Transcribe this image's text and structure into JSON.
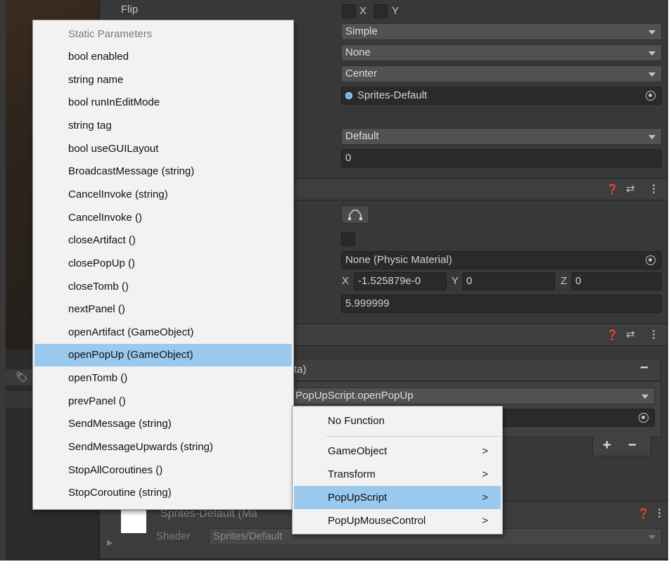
{
  "inspector": {
    "flip_label": "Flip",
    "flip_x": "X",
    "flip_y": "Y",
    "draw_mode": "Simple",
    "mask_interaction": "None",
    "sprite_sort_point": "Center",
    "material": "Sprites-Default",
    "sorting_layer": "Default",
    "order_in_layer": "0",
    "physics_material": "None (Physic Material)",
    "offset_x_label": "X",
    "offset_x": "-1.525879e-0",
    "offset_y_label": "Y",
    "offset_y": "0",
    "offset_z_label": "Z",
    "offset_z": "0",
    "radius": "5.999999",
    "runtime_suffix": "ta)",
    "function_value": "PopUpScript.openPopUp",
    "minus_label": "−",
    "plus_label": "+",
    "material_section_name": "Sprites-Default (Ma",
    "shader_label": "Shader",
    "shader_value": "Sprites/Default"
  },
  "header_icons": {
    "help": "❓",
    "presets": "⇄",
    "more": "⋮"
  },
  "function_menu": {
    "header": "Static Parameters",
    "items": [
      "bool enabled",
      "string name",
      "bool runInEditMode",
      "string tag",
      "bool useGUILayout",
      "BroadcastMessage (string)",
      "CancelInvoke (string)",
      "CancelInvoke ()",
      "closeArtifact ()",
      "closePopUp ()",
      "closeTomb ()",
      "nextPanel ()",
      "openArtifact (GameObject)",
      "openPopUp (GameObject)",
      "openTomb ()",
      "prevPanel ()",
      "SendMessage (string)",
      "SendMessageUpwards (string)",
      "StopAllCoroutines ()",
      "StopCoroutine (string)"
    ],
    "selected_index": 13
  },
  "component_menu": {
    "no_function": "No Function",
    "items": [
      {
        "label": "GameObject",
        "chevron": ">"
      },
      {
        "label": "Transform",
        "chevron": ">"
      },
      {
        "label": "PopUpScript",
        "chevron": ">"
      },
      {
        "label": "PopUpMouseControl",
        "chevron": ">"
      }
    ],
    "selected_index": 2
  },
  "colors": {
    "editor_bg": "#383838",
    "menu_bg": "#f2f2f2",
    "menu_selected": "#99c9ef",
    "field_bg": "#2a2a2a",
    "dropdown_bg": "#515151"
  }
}
